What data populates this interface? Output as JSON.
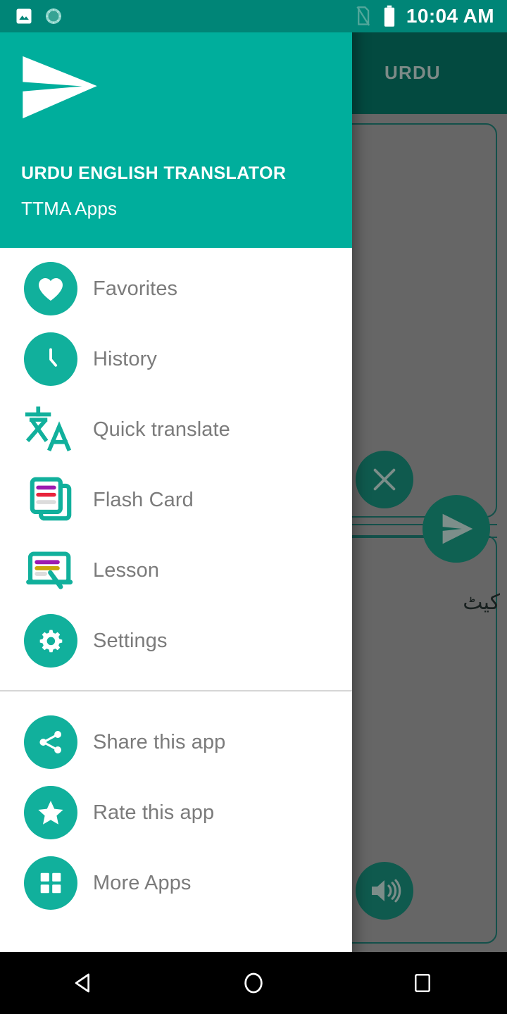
{
  "status_bar": {
    "time": "10:04 AM",
    "background": "#008577",
    "left_icons": [
      "image-icon",
      "sunburst-app-icon"
    ],
    "right_icons": [
      "no-sim-icon",
      "battery-full-icon"
    ]
  },
  "background_app": {
    "appbar_title": "URDU",
    "appbar_color": "#034a40",
    "scrim_color": "#666666",
    "translated_word": "کیٹ",
    "buttons": [
      {
        "name": "clear-button",
        "icon": "close-icon"
      },
      {
        "name": "send-button",
        "icon": "send-icon"
      },
      {
        "name": "speak-button",
        "icon": "volume-up-icon"
      }
    ]
  },
  "drawer": {
    "header": {
      "logo": "send-logo",
      "title": "URDU ENGLISH TRANSLATOR",
      "subtitle": "TTMA Apps",
      "background": "#00ae9c"
    },
    "accent_color": "#11b09c",
    "label_color": "#7b7b7b",
    "primary_items": [
      {
        "label": "Favorites",
        "icon": "heart-icon"
      },
      {
        "label": "History",
        "icon": "clock-icon"
      },
      {
        "label": "Quick translate",
        "icon": "translate-icon"
      },
      {
        "label": "Flash Card",
        "icon": "flash-card-icon"
      },
      {
        "label": "Lesson",
        "icon": "lesson-board-icon"
      },
      {
        "label": "Settings",
        "icon": "gear-icon"
      }
    ],
    "secondary_items": [
      {
        "label": "Share this app",
        "icon": "share-icon"
      },
      {
        "label": "Rate this app",
        "icon": "star-icon"
      },
      {
        "label": "More Apps",
        "icon": "grid-apps-icon"
      }
    ]
  },
  "navigation_bar": {
    "back": "back-triangle-icon",
    "home": "home-circle-icon",
    "recents": "recents-square-icon"
  }
}
